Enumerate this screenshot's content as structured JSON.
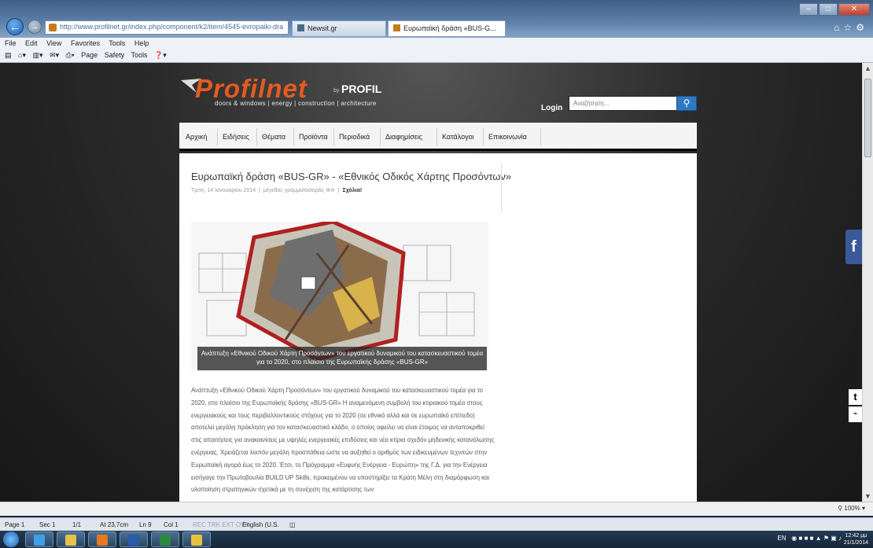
{
  "browser": {
    "address": "http://www.profilnet.gr/index.php/component/k2/item/4545-evropaiki-dra",
    "tabs": [
      "Newsit.gr",
      "Ευρωπαϊκή δράση «BUS-G..."
    ],
    "menu": [
      "File",
      "Edit",
      "View",
      "Favorites",
      "Tools",
      "Help"
    ],
    "commands": [
      "Page",
      "Safety",
      "Tools"
    ],
    "zoom": "100%"
  },
  "site": {
    "logo_text": "Profilnet",
    "logo_by": "by",
    "logo_brand": "PROFIL",
    "tagline": "doors & windows | energy | construction | architecture",
    "login": "Login",
    "search_placeholder": "Αναζήτηση...",
    "nav": [
      "Αρχική",
      "Ειδήσεις",
      "Θέματα",
      "Προϊόντα",
      "Περιοδικά",
      "Διαφημίσεις",
      "Κατάλογοι",
      "Επικοινωνία"
    ]
  },
  "article": {
    "title": "Ευρωπαϊκή δράση «BUS-GR» - «Εθνικός Οδικός Χάρτης Προσόντων»",
    "date": "Τρίτη, 14 Ιανουαρίου 2014",
    "font_size_label": "μέγεθος γραμματοσειράς",
    "comment": "Σχόλια!",
    "caption": "Ανάπτυξη «Εθνικού Οδικού Χάρτη Προσόντων» του εργατικού δυναμικού του κατασκευαστικού τομέα για το 2020, στο πλαίσιο της Ευρωπαϊκής δράσης «BUS-GR»",
    "body": "Ανάπτυξη «Εθνικού Οδικού Χάρτη Προσόντων» του εργατικού δυναμικού του κατασκευαστικού τομέα για το 2020, στο πλαίσιο της Ευρωπαϊκής δράσης «BUS-GR» Η αναμενόμενη συμβολή του κτιριακού τομέα στους ενεργειακούς και τους περιβαλλοντικούς στόχους για το 2020 (σε εθνικό αλλά και σε ευρωπαϊκό επίπεδο) αποτελεί μεγάλη πρόκληση για τον κατασκευαστικό κλάδο, ο οποίος οφείλει να είναι έτοιμος να ανταποκριθεί στις απαιτήσεις για ανακαινίσεις με υψηλές ενεργειακές επιδόσεις και νέα κτίρια σχεδόν μηδενικής κατανάλωσης ενέργειας. Χρειάζεται λοιπόν μεγάλη προσπάθεια ώστε να αυξηθεί ο αριθμός των ειδικευμένων τεχνιτών στην Ευρωπαϊκή αγορά έως το 2020. Έτσι, το Πρόγραμμα «Ευφυής Ενέργεια - Ευρώπη» της Γ.Δ. για την Ενέργεια εισήγαγε την Πρωτοβουλία BUILD UP Skills, προκειμένου να υποστηρίξει τα Κράτη Μέλη στη διαμόρφωση και υλοποίηση στρατηγικών σχετικά με τη συνέχιση της κατάρτισης των"
  },
  "social": {
    "facebook": "f",
    "twitter": "t",
    "rss": "⌁"
  },
  "word_status": {
    "page": "Page 1",
    "sec": "Sec 1",
    "pages": "1/1",
    "at": "At 23,7cm",
    "ln": "Ln 9",
    "col": "Col 1",
    "flags": "REC  TRK  EXT  OVR",
    "lang": "English (U.S."
  },
  "tray": {
    "lang": "EN",
    "time": "12:42 μμ",
    "date": "21/1/2014"
  },
  "colors": {
    "accent_orange": "#e45b20",
    "nav_blue": "#2f78c4",
    "facebook": "#3b5998"
  }
}
